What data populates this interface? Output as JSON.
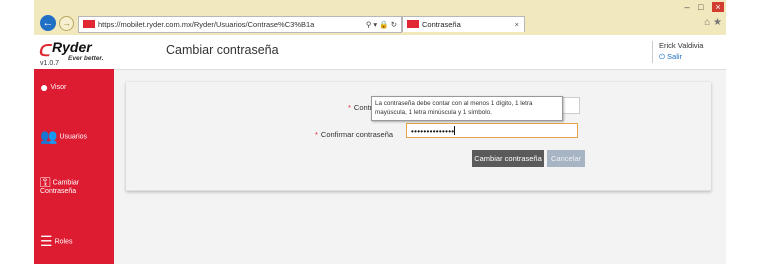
{
  "browser": {
    "url": "https://mobilet.ryder.com.mx/Ryder/Usuarios/Contrase%C3%B1a",
    "tab_title": "Contraseña",
    "back_icon": "back-arrow-icon",
    "home_icon": "home-icon",
    "favorites_icon": "star-icon"
  },
  "header": {
    "brand": "Ryder",
    "tagline": "Ever better.",
    "version": "v1.0.7",
    "page_title": "Cambiar contraseña",
    "user_name": "Erick Valdivia",
    "logout_label": "Salir"
  },
  "sidebar": {
    "items": [
      {
        "label": "Visor",
        "icon": "map-pin-icon"
      },
      {
        "label": "Usuarios",
        "icon": "users-icon"
      },
      {
        "label": "Cambiar Contraseña",
        "icon": "key-icon"
      },
      {
        "label": "Roles",
        "icon": "list-icon"
      }
    ]
  },
  "form": {
    "password_label": "Contraseña",
    "password_label_visible": "Contr",
    "confirm_label": "Confirmar contraseña",
    "confirm_value": "••••••••••••••",
    "tooltip_text": "La contraseña debe contar con al menos 1 dígito, 1 letra mayúscula, 1 letra minúscula y 1 símbolo.",
    "save_label": "Cambiar contraseña",
    "cancel_label": "Cancelar"
  },
  "colors": {
    "brand_red": "#dd1b31",
    "primary_button": "#5a5a5a",
    "disabled_button": "#a6b4c4",
    "focus_border": "#e9a24a"
  }
}
